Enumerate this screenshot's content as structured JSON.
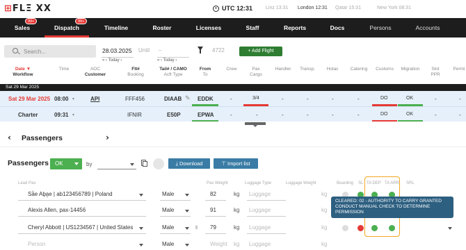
{
  "topbar": {
    "logo": "FLΞ XX",
    "logo_mark": "⊞",
    "utc": "UTC 12:31",
    "cities": [
      "Linz 13:31",
      "London 12:31",
      "Qatar 15:31",
      "New York 08:31"
    ]
  },
  "nav": {
    "items": [
      "Sales",
      "Dispatch",
      "Timeline",
      "Roster",
      "Licenses",
      "Staff",
      "Reports",
      "Docs",
      "Persons",
      "Accounts"
    ],
    "badges": [
      "99+",
      "99+"
    ]
  },
  "filters": {
    "search_placeholder": "Search...",
    "date_from": "28.03.2025",
    "until_label": "Until",
    "until_value": "–",
    "today_prev": "« ‹  Today  ›",
    "today_next": "« ‹  Today  ›",
    "count": "4722",
    "add_flight": "+ Add Flight"
  },
  "columns": [
    {
      "a": "Date ▼",
      "b": "Workflow"
    },
    {
      "a": "Time",
      "b": ""
    },
    {
      "a": "AOC",
      "b": "Customer"
    },
    {
      "a": "Flt#",
      "b": "Booking"
    },
    {
      "a": "Tail# / CAMO",
      "b": "Acft Type"
    },
    {
      "a": "From",
      "b": "To"
    },
    {
      "a": "Crew",
      "b": ""
    },
    {
      "a": "Pax",
      "b": "Cargo"
    },
    {
      "a": "Handler",
      "b": ""
    },
    {
      "a": "Transp.",
      "b": ""
    },
    {
      "a": "Hotac",
      "b": ""
    },
    {
      "a": "Catering",
      "b": ""
    },
    {
      "a": "Customs",
      "b": ""
    },
    {
      "a": "Migration",
      "b": ""
    },
    {
      "a": "Slot",
      "b": "PPR"
    },
    {
      "a": "Permi",
      "b": ""
    }
  ],
  "date_band": "Sat 29 Mar 2025",
  "flights": [
    {
      "date": "Sat 29 Mar 2025",
      "time": "08:00",
      "customer": "API",
      "flt": "FFF456",
      "tail": "DIAAB",
      "from": "EDDK",
      "crew": "-",
      "pax": "3/4",
      "handler": "-",
      "transp": "-",
      "hotac": "-",
      "catering": "-",
      "customs": "DO",
      "migration": "OK",
      "slot": "-",
      "permit": "-"
    },
    {
      "date": "Charter",
      "time": "09:31",
      "customer": "",
      "flt": "IFNIR",
      "tail": "E50P",
      "from": "EPWA",
      "crew": "-",
      "pax": "-",
      "handler": "-",
      "transp": "-",
      "hotac": "-",
      "catering": "-",
      "customs": "DO",
      "migration": "OK",
      "slot": "-",
      "permit": "-"
    }
  ],
  "panel": {
    "title": "Passengers",
    "section_title": "Passengers",
    "status": "OK",
    "by_label": "by",
    "download": "⤓ Download",
    "import": "⊤ Import list"
  },
  "pax_labels": {
    "lead": "Lead Pax",
    "weight": "Pax Weight",
    "luggage_type": "Luggage Type",
    "luggage_weight": "Luggage Weight",
    "boarding": "Boarding",
    "sl": "SL",
    "ta_dep": "TA DEP",
    "ta_arr": "TA ARR",
    "srl": "SRL"
  },
  "passengers": [
    {
      "name": "Sä̈e Aḇa̱e | ab123456789 | Poland",
      "gender": "Male",
      "weight": "82",
      "unit": "kg",
      "luggage": "Luggage",
      "lw_unit": "kg"
    },
    {
      "name": "Alexis Allen, pax-14456",
      "gender": "Male",
      "weight": "91",
      "unit": "kg",
      "luggage": "Luggage",
      "lw_unit": "kg"
    },
    {
      "name": "Cheryl Abbott | US1234567 | United States",
      "gender": "Male",
      "weight": "79",
      "unit": "kg",
      "luggage": "Luggage",
      "lw_unit": "kg"
    },
    {
      "name": "Person",
      "gender": "Male",
      "weight": "Weight",
      "unit": "kg",
      "luggage": "Luggage",
      "lw_unit": "kg"
    }
  ],
  "tooltip": "CLEARED: 02 - AUTHORITY TO CARRY GRANTED CONDUCT MANUAL CHECK TO DETERMINE PERMISSION",
  "colors": {
    "accent": "#e53935",
    "ok": "#4caf50",
    "nav_bg": "#1d1d1d",
    "button_blue": "#3a7ca5",
    "highlight": "#f5a623"
  }
}
